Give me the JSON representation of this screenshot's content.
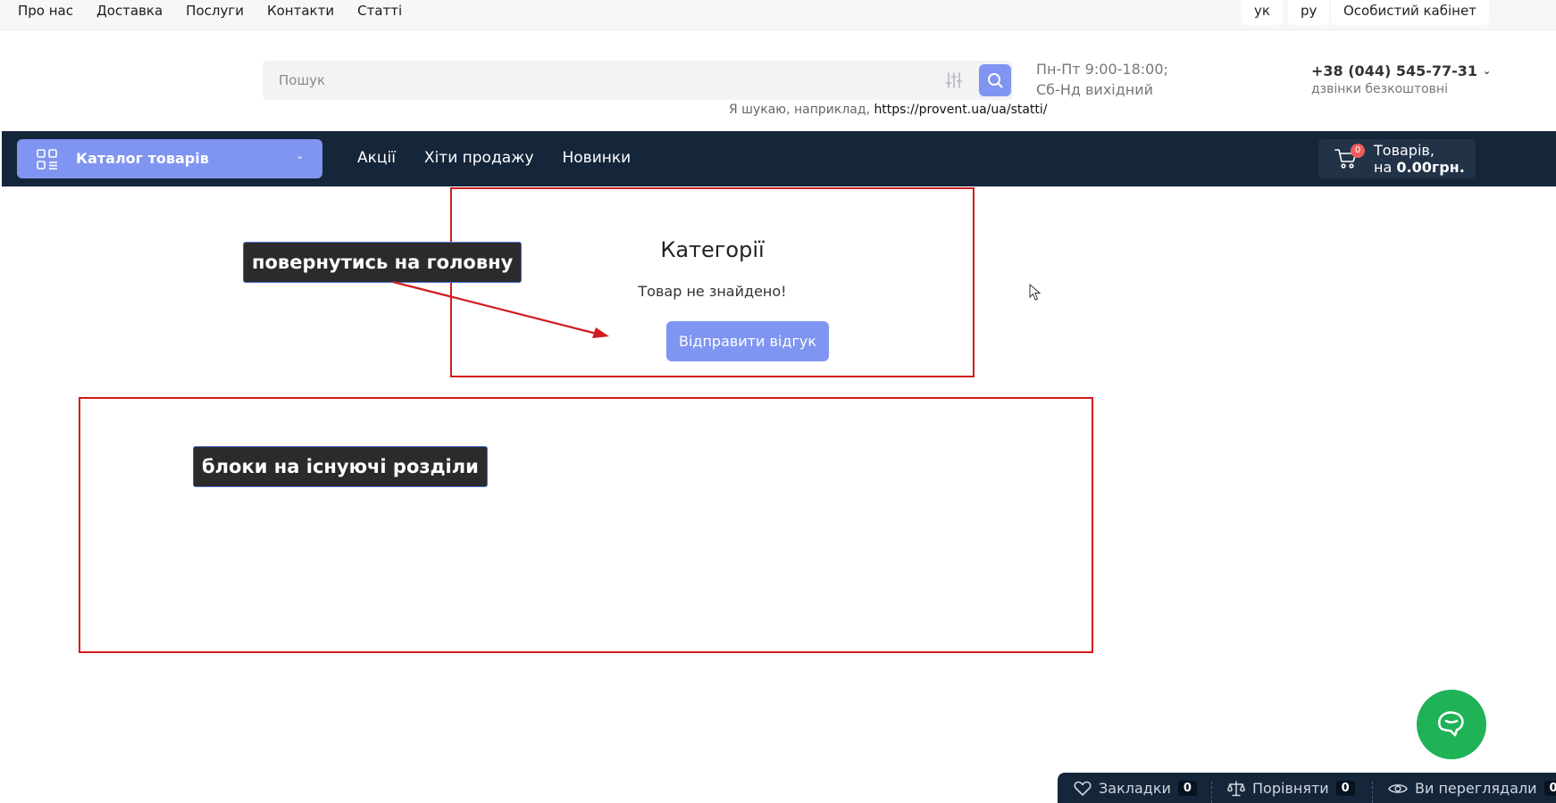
{
  "topbar": {
    "links": [
      "Про нас",
      "Доставка",
      "Послуги",
      "Контакти",
      "Статті"
    ],
    "langs": [
      "ук",
      "ру"
    ],
    "cabinet": "Особистий кабінет"
  },
  "header": {
    "search_placeholder": "Пошук",
    "hint_prefix": "Я шукаю, наприклад,",
    "hint_link": "https://provent.ua/ua/statti/",
    "hours_1": "Пн-Пт 9:00-18:00;",
    "hours_2": "Сб-Нд вихідний",
    "phone": "+38 (044) 545-77-31",
    "phone_sub": "дзвінки безкоштовні"
  },
  "nav": {
    "catalog_label": "Каталог товарів",
    "links": [
      "Акції",
      "Хіти продажу",
      "Новинки"
    ],
    "cart_count": "0",
    "cart_line1": "Товарів,",
    "cart_prefix": "на",
    "cart_total": "0.00грн."
  },
  "content": {
    "title": "Категорії",
    "not_found": "Товар не знайдено!",
    "feedback_button": "Відправити відгук"
  },
  "annotations": {
    "note_1": "повернутись на головну",
    "note_2": "блоки на існуючі розділи"
  },
  "bottom_bar": {
    "bookmarks": "Закладки",
    "bookmarks_count": "0",
    "compare": "Порівняти",
    "compare_count": "0",
    "viewed": "Ви переглядали",
    "viewed_count": "0"
  },
  "colors": {
    "accent": "#7f95f1",
    "nav_bg": "#15263a",
    "annotation_red": "#d11c1c",
    "chat_green": "#1fb256",
    "badge_red": "#ef5b5b"
  }
}
